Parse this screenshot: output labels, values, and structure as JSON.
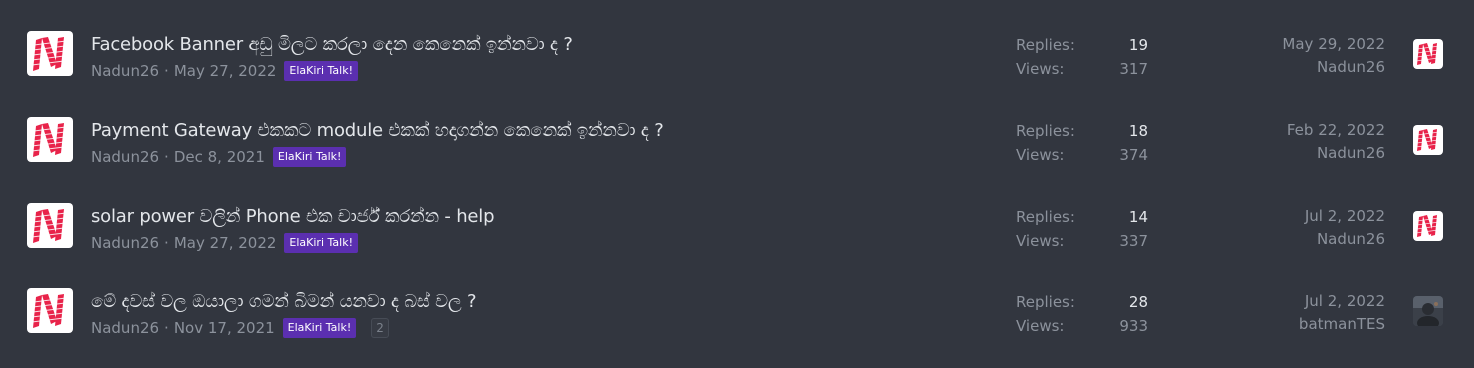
{
  "threads": [
    {
      "title": "Facebook Banner අඩු මිලට කරලා දෙන කෙනෙක් ඉන්නවා ද ?",
      "author": "Nadun26",
      "date": "May 27, 2022",
      "prefix": "ElaKiri Talk!",
      "replies_label": "Replies:",
      "replies": "19",
      "views_label": "Views:",
      "views": "317",
      "last_post_date": "May 29, 2022",
      "last_post_user": "Nadun26",
      "avatar_icon": "n-logo-icon",
      "last_avatar_icon": "n-logo-icon"
    },
    {
      "title": "Payment Gateway එකකට module එකක් හදාගන්න කෙනෙක් ඉන්නවා ද ?",
      "author": "Nadun26",
      "date": "Dec 8, 2021",
      "prefix": "ElaKiri Talk!",
      "replies_label": "Replies:",
      "replies": "18",
      "views_label": "Views:",
      "views": "374",
      "last_post_date": "Feb 22, 2022",
      "last_post_user": "Nadun26",
      "avatar_icon": "n-logo-icon",
      "last_avatar_icon": "n-logo-icon"
    },
    {
      "title": "solar power වලින් Phone එක චාර්ජ් කරන්න - help",
      "author": "Nadun26",
      "date": "May 27, 2022",
      "prefix": "ElaKiri Talk!",
      "replies_label": "Replies:",
      "replies": "14",
      "views_label": "Views:",
      "views": "337",
      "last_post_date": "Jul 2, 2022",
      "last_post_user": "Nadun26",
      "avatar_icon": "n-logo-icon",
      "last_avatar_icon": "n-logo-icon"
    },
    {
      "title": "මේ දවස් වල ඔයාලා ගමන් බිමන් යනවා ද බස් වල ?",
      "author": "Nadun26",
      "date": "Nov 17, 2021",
      "prefix": "ElaKiri Talk!",
      "page_jump": "2",
      "replies_label": "Replies:",
      "replies": "28",
      "views_label": "Views:",
      "views": "933",
      "last_post_date": "Jul 2, 2022",
      "last_post_user": "batmanTES",
      "avatar_icon": "n-logo-icon",
      "last_avatar_icon": "user-photo-icon"
    }
  ],
  "meta_separator": "·",
  "colors": {
    "background": "#32363f",
    "title_text": "#e3e6ea",
    "muted_text": "#8c929c",
    "prefix_badge": "#5b2fb0",
    "logo_red": "#e8234a",
    "avatar_bg": "#ffffff"
  }
}
